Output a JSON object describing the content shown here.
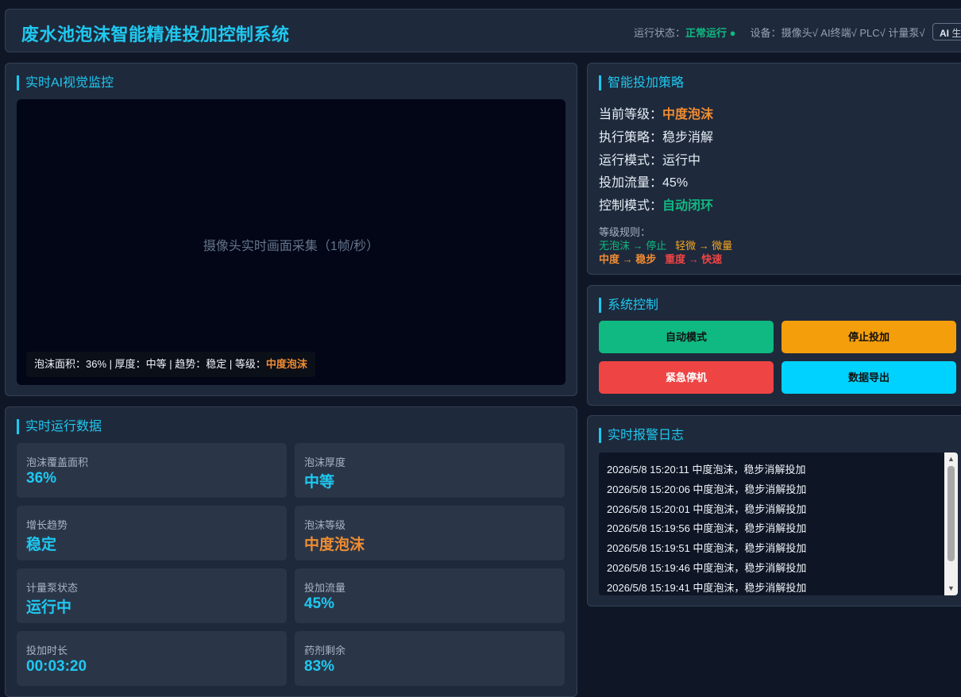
{
  "header": {
    "title": "废水池泡沫智能精准投加控制系统",
    "status_label": "运行状态：",
    "status_value": "正常运行 ●",
    "devices_label": "设备：",
    "devices_value": "摄像头√ AI终端√ PLC√ 计量泵√",
    "ai_badge_strong": "AI",
    "ai_badge_rest": " 生成"
  },
  "video_panel": {
    "title": "实时AI视觉监控",
    "placeholder": "摄像头实时画面采集（1帧/秒）",
    "overlay_text": "泡沫面积：36% | 厚度：中等 | 趋势：稳定 | 等级：",
    "overlay_level": "中度泡沫"
  },
  "data_panel": {
    "title": "实时运行数据",
    "cards": [
      {
        "label": "泡沫覆盖面积",
        "value": "36%"
      },
      {
        "label": "泡沫厚度",
        "value": "中等"
      },
      {
        "label": "增长趋势",
        "value": "稳定"
      },
      {
        "label": "泡沫等级",
        "value": "中度泡沫"
      },
      {
        "label": "计量泵状态",
        "value": "运行中"
      },
      {
        "label": "投加流量",
        "value": "45%"
      },
      {
        "label": "投加时长",
        "value": "00:03:20"
      },
      {
        "label": "药剂剩余",
        "value": "83%"
      }
    ]
  },
  "strategy": {
    "title": "智能投加策略",
    "level_label": "当前等级：",
    "level_value": "中度泡沫",
    "policy_label": "执行策略：",
    "policy_value": "稳步消解",
    "mode_label": "运行模式：",
    "mode_value": "运行中",
    "flow_label": "投加流量：",
    "flow_value": "45%",
    "control_label": "控制模式：",
    "control_value": "自动闭环",
    "rules_title": "等级规则：",
    "rule_none": "无泡沫 → 停止",
    "rule_light": "轻微 → 微量",
    "rule_medium": "中度 → 稳步",
    "rule_heavy": "重度 → 快速"
  },
  "control": {
    "title": "系统控制",
    "auto": "自动模式",
    "stop": "停止投加",
    "emergency": "紧急停机",
    "export": "数据导出"
  },
  "log": {
    "title": "实时报警日志",
    "entries": [
      "2026/5/8 15:20:11 中度泡沫，稳步消解投加",
      "2026/5/8 15:20:06 中度泡沫，稳步消解投加",
      "2026/5/8 15:20:01 中度泡沫，稳步消解投加",
      "2026/5/8 15:19:56 中度泡沫，稳步消解投加",
      "2026/5/8 15:19:51 中度泡沫，稳步消解投加",
      "2026/5/8 15:19:46 中度泡沫，稳步消解投加",
      "2026/5/8 15:19:41 中度泡沫，稳步消解投加"
    ]
  },
  "colors": {
    "accent": "#1fc8f0",
    "ok": "#10b981",
    "warning": "#f08c32",
    "danger": "#ef4444"
  }
}
